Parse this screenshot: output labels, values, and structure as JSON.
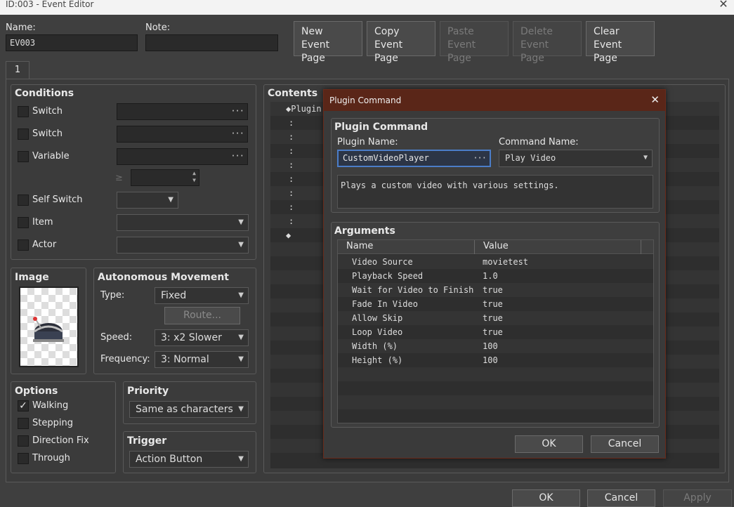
{
  "window": {
    "title": "ID:003 - Event Editor",
    "close": "✕"
  },
  "header": {
    "name_label": "Name:",
    "name_value": "EV003",
    "note_label": "Note:",
    "note_value": "",
    "buttons": [
      {
        "line1": "New",
        "line2": "Event Page",
        "disabled": false
      },
      {
        "line1": "Copy",
        "line2": "Event Page",
        "disabled": false
      },
      {
        "line1": "Paste",
        "line2": "Event Page",
        "disabled": true
      },
      {
        "line1": "Delete",
        "line2": "Event Page",
        "disabled": true
      },
      {
        "line1": "Clear",
        "line2": "Event Page",
        "disabled": false
      }
    ],
    "tab": "1"
  },
  "conditions": {
    "title": "Conditions",
    "switch1": "Switch",
    "switch2": "Switch",
    "variable": "Variable",
    "gte": "≥",
    "self_switch": "Self Switch",
    "item": "Item",
    "actor": "Actor"
  },
  "image": {
    "title": "Image"
  },
  "movement": {
    "title": "Autonomous Movement",
    "type_label": "Type:",
    "type_value": "Fixed",
    "route": "Route...",
    "speed_label": "Speed:",
    "speed_value": "3: x2 Slower",
    "freq_label": "Frequency:",
    "freq_value": "3: Normal"
  },
  "options": {
    "title": "Options",
    "walking": "Walking",
    "stepping": "Stepping",
    "direction_fix": "Direction Fix",
    "through": "Through"
  },
  "priority": {
    "title": "Priority",
    "value": "Same as characters"
  },
  "trigger": {
    "title": "Trigger",
    "value": "Action Button"
  },
  "contents": {
    "title": "Contents",
    "first": "◆Plugin",
    "colon": ":",
    "end": "◆"
  },
  "footer": {
    "ok": "OK",
    "cancel": "Cancel",
    "apply": "Apply"
  },
  "dialog": {
    "title": "Plugin Command",
    "close": "✕",
    "section_title": "Plugin Command",
    "plugin_name_label": "Plugin Name:",
    "plugin_name_value": "CustomVideoPlayer",
    "command_name_label": "Command Name:",
    "command_name_value": "Play Video",
    "description": "Plays a custom video with various settings.",
    "arguments_title": "Arguments",
    "col_name": "Name",
    "col_value": "Value",
    "args": [
      {
        "name": "Video Source",
        "value": "movietest"
      },
      {
        "name": "Playback Speed",
        "value": "1.0"
      },
      {
        "name": "Wait for Video to Finish",
        "value": "true"
      },
      {
        "name": "Fade In Video",
        "value": "true"
      },
      {
        "name": "Allow Skip",
        "value": "true"
      },
      {
        "name": "Loop Video",
        "value": "true"
      },
      {
        "name": "Width (%)",
        "value": "100"
      },
      {
        "name": "Height (%)",
        "value": "100"
      }
    ],
    "ok": "OK",
    "cancel": "Cancel"
  }
}
